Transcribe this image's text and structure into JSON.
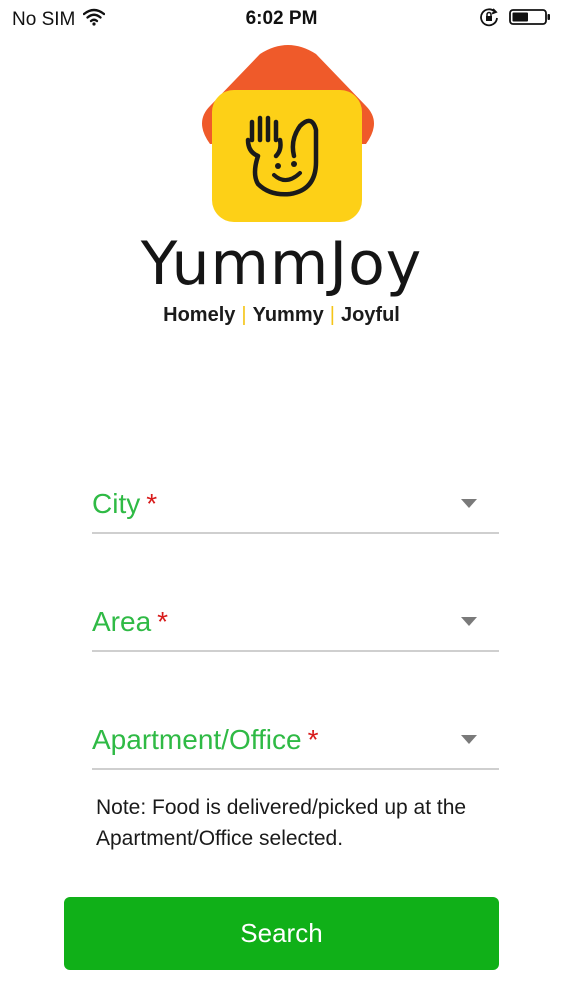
{
  "status_bar": {
    "carrier": "No SIM",
    "time": "6:02 PM",
    "wifi_icon": "wifi-icon",
    "rotation_lock_icon": "rotation-lock-icon",
    "battery_icon": "battery-icon",
    "battery_level": 0.5
  },
  "brand": {
    "name": "YummJoy",
    "tagline": {
      "part1": "Homely",
      "part2": "Yummy",
      "part3": "Joyful",
      "separator": "|"
    },
    "colors": {
      "roof": "#ef5a2a",
      "tile": "#fdd017",
      "accent_green": "#2fba45",
      "button_green": "#10b018",
      "required_red": "#d81b1b"
    }
  },
  "form": {
    "city": {
      "label": "City",
      "required_mark": "*"
    },
    "area": {
      "label": "Area",
      "required_mark": "*"
    },
    "apartment": {
      "label": "Apartment/Office",
      "required_mark": "*"
    },
    "note": "Note: Food is delivered/picked up at the Apartment/Office selected.",
    "search_label": "Search"
  }
}
